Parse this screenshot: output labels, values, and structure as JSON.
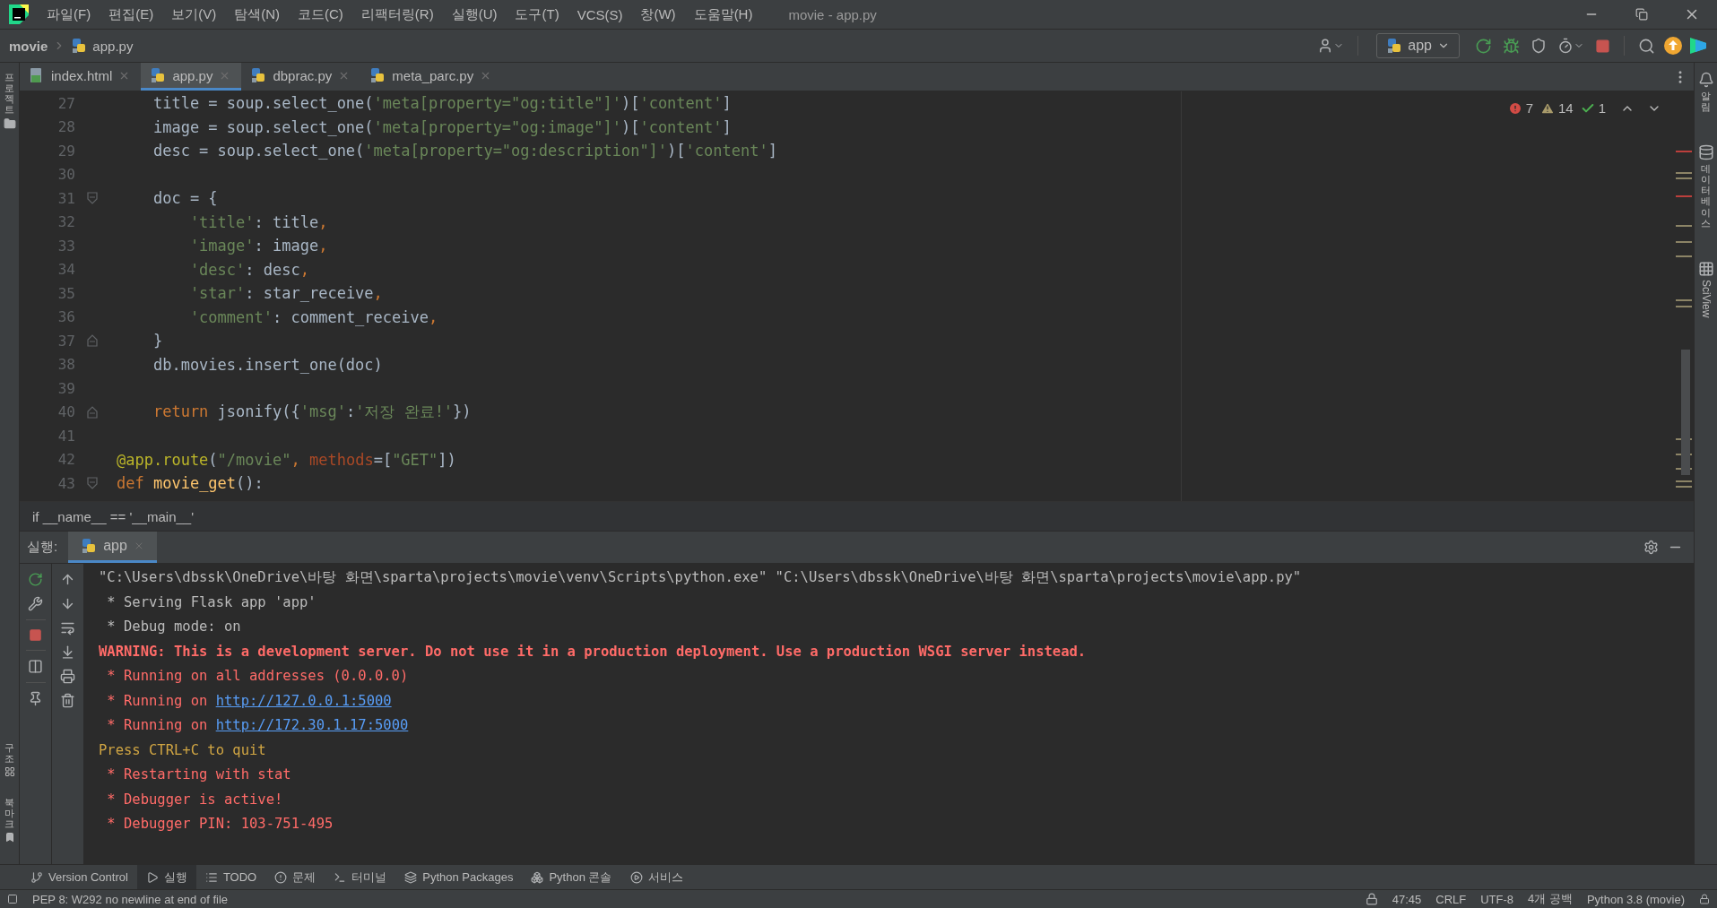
{
  "title_bar": {
    "menu": [
      "파일(F)",
      "편집(E)",
      "보기(V)",
      "탐색(N)",
      "코드(C)",
      "리팩터링(R)",
      "실행(U)",
      "도구(T)",
      "VCS(S)",
      "창(W)",
      "도움말(H)"
    ],
    "title": "movie - app.py"
  },
  "nav_bar": {
    "breadcrumb": [
      "movie",
      "app.py"
    ],
    "run_config": "app"
  },
  "left_strip": {
    "top": [
      {
        "label": "프로젝트"
      }
    ],
    "bottom": [
      {
        "label": "구조"
      },
      {
        "label": "북마크"
      }
    ]
  },
  "right_strip": [
    {
      "label": "알림",
      "kind": "bell"
    },
    {
      "label": "데이터베이스",
      "kind": "database"
    },
    {
      "label": "SciView",
      "kind": "grid"
    }
  ],
  "tabs": [
    {
      "label": "index.html",
      "kind": "html",
      "selected": false
    },
    {
      "label": "app.py",
      "kind": "python",
      "selected": true
    },
    {
      "label": "dbprac.py",
      "kind": "python",
      "selected": false
    },
    {
      "label": "meta_parc.py",
      "kind": "python",
      "selected": false
    }
  ],
  "editor": {
    "inspections": {
      "errors": "7",
      "warnings": "14",
      "typos": "1"
    },
    "lines": [
      {
        "number": "27",
        "kind": "code",
        "tokens": [
          {
            "kind": "plain",
            "text": "    title = soup.select_one("
          },
          {
            "kind": "string",
            "text": "'meta[property=\"og:title\"]'"
          },
          {
            "kind": "plain",
            "text": ")["
          },
          {
            "kind": "string",
            "text": "'content'"
          },
          {
            "kind": "plain",
            "text": "]"
          }
        ]
      },
      {
        "number": "28",
        "kind": "code",
        "tokens": [
          {
            "kind": "plain",
            "text": "    image = soup.select_one("
          },
          {
            "kind": "string",
            "text": "'meta[property=\"og:image\"]'"
          },
          {
            "kind": "plain",
            "text": ")["
          },
          {
            "kind": "string",
            "text": "'content'"
          },
          {
            "kind": "plain",
            "text": "]"
          }
        ]
      },
      {
        "number": "29",
        "kind": "code",
        "tokens": [
          {
            "kind": "plain",
            "text": "    desc = soup.select_one("
          },
          {
            "kind": "string",
            "text": "'meta[property=\"og:description\"]'"
          },
          {
            "kind": "plain",
            "text": ")["
          },
          {
            "kind": "string",
            "text": "'content'"
          },
          {
            "kind": "plain",
            "text": "]"
          }
        ]
      },
      {
        "number": "30",
        "kind": "code"
      },
      {
        "number": "31",
        "kind": "fold_start",
        "tokens": [
          {
            "kind": "plain",
            "text": "    doc = {"
          }
        ]
      },
      {
        "number": "32",
        "kind": "code",
        "tokens": [
          {
            "kind": "string",
            "text": "        'title'"
          },
          {
            "kind": "plain",
            "text": ": title"
          },
          {
            "kind": "punct",
            "text": ","
          }
        ]
      },
      {
        "number": "33",
        "kind": "code",
        "tokens": [
          {
            "kind": "string",
            "text": "        'image'"
          },
          {
            "kind": "plain",
            "text": ": image"
          },
          {
            "kind": "punct",
            "text": ","
          }
        ]
      },
      {
        "number": "34",
        "kind": "code",
        "tokens": [
          {
            "kind": "string",
            "text": "        'desc'"
          },
          {
            "kind": "plain",
            "text": ": desc"
          },
          {
            "kind": "punct",
            "text": ","
          }
        ]
      },
      {
        "number": "35",
        "kind": "code",
        "tokens": [
          {
            "kind": "string",
            "text": "        'star'"
          },
          {
            "kind": "plain",
            "text": ": star_receive"
          },
          {
            "kind": "punct",
            "text": ","
          }
        ]
      },
      {
        "number": "36",
        "kind": "code",
        "tokens": [
          {
            "kind": "string",
            "text": "        'comment'"
          },
          {
            "kind": "plain",
            "text": ": comment_receive"
          },
          {
            "kind": "punct",
            "text": ","
          }
        ]
      },
      {
        "number": "37",
        "kind": "fold_end",
        "tokens": [
          {
            "kind": "plain",
            "text": "    }"
          }
        ]
      },
      {
        "number": "38",
        "kind": "code",
        "tokens": [
          {
            "kind": "plain",
            "text": "    db.movies.insert_one(doc)"
          }
        ]
      },
      {
        "number": "39",
        "kind": "code"
      },
      {
        "number": "40",
        "kind": "fold_end",
        "tokens": [
          {
            "kind": "keyword",
            "text": "    return"
          },
          {
            "kind": "plain",
            "text": " jsonify({"
          },
          {
            "kind": "string",
            "text": "'msg'"
          },
          {
            "kind": "plain",
            "text": ":"
          },
          {
            "kind": "string",
            "text": "'저장 완료!'"
          },
          {
            "kind": "plain",
            "text": "})"
          }
        ]
      },
      {
        "number": "41",
        "kind": "code"
      },
      {
        "number": "42",
        "kind": "code",
        "tokens": [
          {
            "kind": "decorator",
            "text": "@app.route"
          },
          {
            "kind": "plain",
            "text": "("
          },
          {
            "kind": "string",
            "text": "\"/movie\""
          },
          {
            "kind": "punct",
            "text": ","
          },
          {
            "kind": "param",
            "text": " methods"
          },
          {
            "kind": "plain",
            "text": "=["
          },
          {
            "kind": "string",
            "text": "\"GET\""
          },
          {
            "kind": "plain",
            "text": "])"
          }
        ]
      },
      {
        "number": "43",
        "kind": "fold_start",
        "tokens": [
          {
            "kind": "keyword",
            "text": "def"
          },
          {
            "kind": "function",
            "text": " movie_get"
          },
          {
            "kind": "plain",
            "text": "():"
          }
        ]
      }
    ],
    "breadcrumb": "if __name__ == '__main__'"
  },
  "run": {
    "label": "실행:",
    "tabs": [
      {
        "label": "app",
        "selected": true
      }
    ],
    "output": [
      {
        "kind": "command",
        "parts": [
          {
            "text": "\"C:\\Users\\dbssk\\OneDrive\\바탕 화면\\sparta\\projects\\movie\\venv\\Scripts\\python.exe\" \"C:\\Users\\dbssk\\OneDrive\\바탕 화면\\sparta\\projects\\movie\\app.py\"",
            "link": false
          }
        ]
      },
      {
        "kind": "info",
        "parts": [
          {
            "text": " * Serving Flask app 'app'",
            "link": false
          }
        ]
      },
      {
        "kind": "info",
        "parts": [
          {
            "text": " * Debug mode: on",
            "link": false
          }
        ]
      },
      {
        "kind": "warning",
        "parts": [
          {
            "text": "WARNING: This is a development server. Do not use it in a production deployment. Use a production WSGI server instead.",
            "link": false
          }
        ]
      },
      {
        "kind": "error",
        "parts": [
          {
            "text": " * Running on all addresses (0.0.0.0)",
            "link": false
          }
        ]
      },
      {
        "kind": "error",
        "parts": [
          {
            "text": " * Running on",
            "link": false
          },
          {
            "text": "http://127.0.0.1:5000",
            "link": true
          }
        ]
      },
      {
        "kind": "error",
        "parts": [
          {
            "text": " * Running on",
            "link": false
          },
          {
            "text": "http://172.30.1.17:5000",
            "link": true
          }
        ]
      },
      {
        "kind": "notice",
        "parts": [
          {
            "text": "Press CTRL+C to quit",
            "link": false
          }
        ]
      },
      {
        "kind": "error",
        "parts": [
          {
            "text": " * Restarting with stat",
            "link": false
          }
        ]
      },
      {
        "kind": "error",
        "parts": [
          {
            "text": " * Debugger is active!",
            "link": false
          }
        ]
      },
      {
        "kind": "error",
        "parts": [
          {
            "text": " * Debugger PIN: 103-751-495",
            "link": false
          }
        ]
      }
    ]
  },
  "tool_tabs": [
    {
      "label": "Version Control",
      "kind": "vcs",
      "selected": false
    },
    {
      "label": "실행",
      "kind": "run",
      "selected": true
    },
    {
      "label": "TODO",
      "kind": "todo",
      "selected": false
    },
    {
      "label": "문제",
      "kind": "problems",
      "selected": false
    },
    {
      "label": "터미널",
      "kind": "terminal",
      "selected": false
    },
    {
      "label": "Python Packages",
      "kind": "packages",
      "selected": false
    },
    {
      "label": "Python 콘솔",
      "kind": "console",
      "selected": false
    },
    {
      "label": "서비스",
      "kind": "services",
      "selected": false
    }
  ],
  "status_bar": {
    "message": "PEP 8: W292 no newline at end of file",
    "items": [
      "47:45",
      "CRLF",
      "UTF-8",
      "4개 공백",
      "Python 3.8 (movie)"
    ]
  }
}
